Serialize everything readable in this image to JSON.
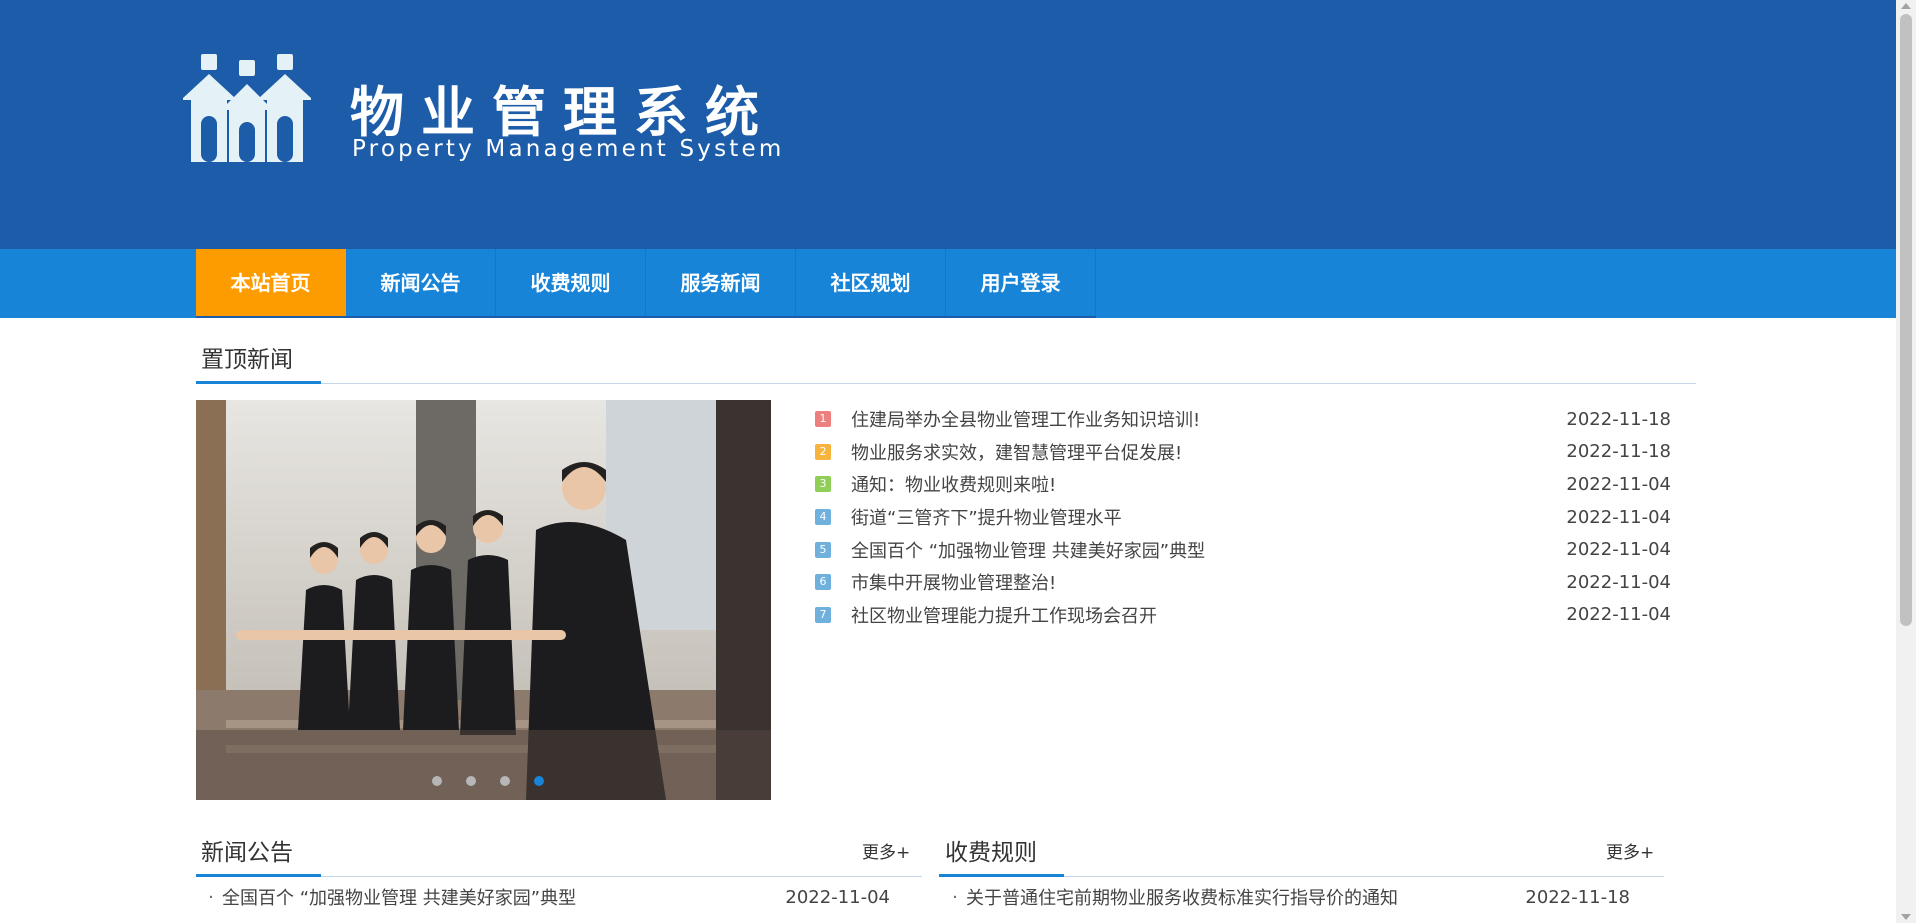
{
  "header": {
    "title": "物业管理系统",
    "subtitle": "Property Management System",
    "logo_icon": "house-people-logo-icon",
    "background_color": "#1d5ca8"
  },
  "nav": {
    "items": [
      "本站首页",
      "新闻公告",
      "收费规则",
      "服务新闻",
      "社区规划",
      "用户登录"
    ],
    "active_index": 0,
    "bar_color": "#1784d8",
    "active_color": "#fd9c00"
  },
  "top_news": {
    "heading": "置顶新闻",
    "items": [
      {
        "num": "1",
        "title": "住建局举办全县物业管理工作业务知识培训!",
        "date": "2022-11-18",
        "color": "#ee7f7f"
      },
      {
        "num": "2",
        "title": "物业服务求实效，建智慧管理平台促发展!",
        "date": "2022-11-18",
        "color": "#f7b43d"
      },
      {
        "num": "3",
        "title": "通知：物业收费规则来啦!",
        "date": "2022-11-04",
        "color": "#8fcf58"
      },
      {
        "num": "4",
        "title": "街道“三管齐下”提升物业管理水平",
        "date": "2022-11-04",
        "color": "#6fb0dd"
      },
      {
        "num": "5",
        "title": "全国百个 “加强物业管理 共建美好家园”典型",
        "date": "2022-11-04",
        "color": "#6fb0dd"
      },
      {
        "num": "6",
        "title": "市集中开展物业管理整治!",
        "date": "2022-11-04",
        "color": "#6fb0dd"
      },
      {
        "num": "7",
        "title": "社区物业管理能力提升工作现场会召开",
        "date": "2022-11-04",
        "color": "#6fb0dd"
      }
    ]
  },
  "slider": {
    "slides": 4,
    "active_slide": 3
  },
  "news_notice": {
    "heading": "新闻公告",
    "more": "更多+",
    "items": [
      {
        "title": "全国百个 “加强物业管理 共建美好家园”典型",
        "date": "2022-11-04"
      }
    ]
  },
  "fee_rules": {
    "heading": "收费规则",
    "more": "更多+",
    "items": [
      {
        "title": "关于普通住宅前期物业服务收费标准实行指导价的通知",
        "date": "2022-11-18"
      }
    ]
  }
}
